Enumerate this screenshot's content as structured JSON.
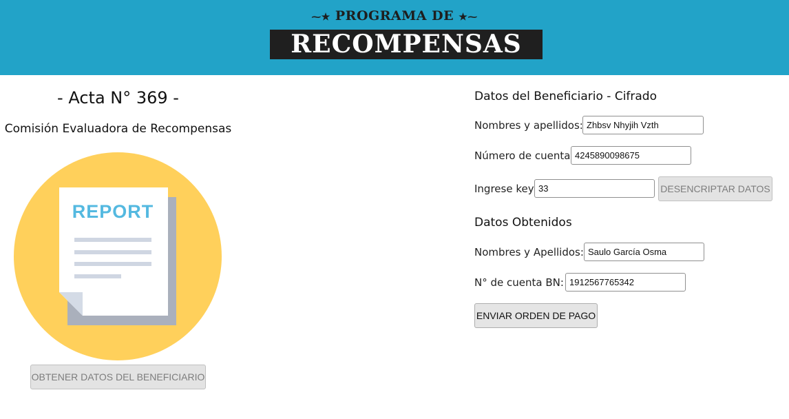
{
  "header": {
    "logo_top": "PROGRAMA DE",
    "logo_main": "RECOMPENSAS"
  },
  "left": {
    "acta_title": "- Acta N° 369 -",
    "comision": "Comisión Evaluadora de Recompensas",
    "report_label": "REPORT",
    "obtener_button": "OBTENER DATOS DEL BENEFICIARIO"
  },
  "cifrado": {
    "title": "Datos del Beneficiario - Cifrado",
    "nombres_label": "Nombres y apellidos:",
    "nombres_value": "Zhbsv Nhyjih Vzth",
    "cuenta_label": "Número de cuenta",
    "cuenta_value": "4245890098675",
    "key_label": "Ingrese key:",
    "key_value": "33",
    "desencriptar_button": "DESENCRIPTAR DATOS"
  },
  "obtenidos": {
    "title": "Datos Obtenidos",
    "nombres_label": "Nombres y Apellidos:",
    "nombres_value": "Saulo García Osma",
    "cuenta_label": "N° de cuenta BN:",
    "cuenta_value": "1912567765342",
    "enviar_button": "ENVIAR ORDEN DE PAGO"
  },
  "colors": {
    "header_bg": "#22a3c8",
    "circle": "#ffd05b",
    "report_text": "#54b9e0",
    "paper_shadow": "#aab0bc"
  }
}
